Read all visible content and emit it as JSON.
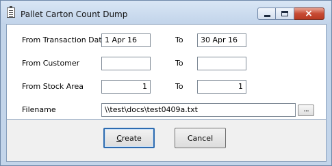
{
  "window": {
    "title": "Pallet Carton Count Dump",
    "icon": "document-list-icon",
    "controls": {
      "minimize": "minimize-icon",
      "maximize": "maximize-icon",
      "close": "×"
    }
  },
  "form": {
    "transaction_date": {
      "label": "From Transaction Date",
      "from": "1 Apr 16",
      "to_label": "To",
      "to": "30 Apr 16"
    },
    "customer": {
      "label": "From Customer",
      "from": "",
      "to_label": "To",
      "to": ""
    },
    "stock_area": {
      "label": "From Stock Area",
      "from": "1",
      "to_label": "To",
      "to": "1"
    },
    "filename": {
      "label": "Filename",
      "value": "\\\\test\\docs\\test0409a.txt",
      "browse_label": "..."
    }
  },
  "buttons": {
    "create_access_key": "C",
    "create_rest": "reate",
    "cancel": "Cancel"
  }
}
